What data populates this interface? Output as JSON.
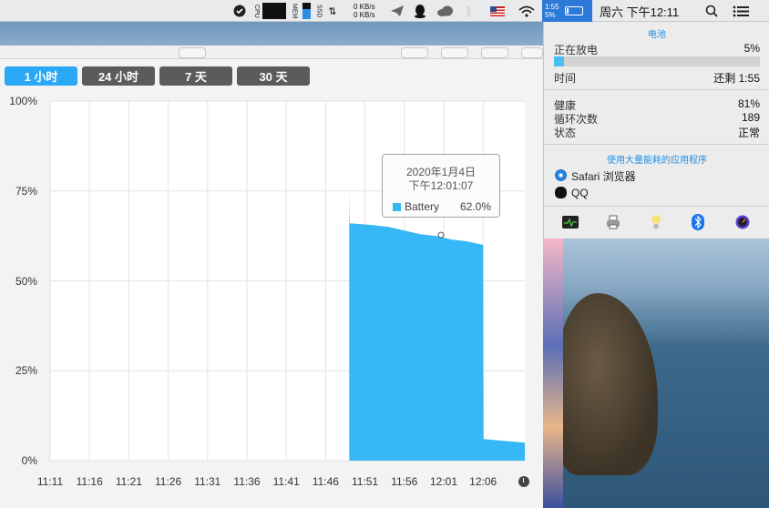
{
  "menubar": {
    "cpu_label": "CPU",
    "mem_label": "MEM",
    "ssd_label": "SSD",
    "net_up": "0 KB/s",
    "net_down": "0 KB/s",
    "battery_time": "1:55",
    "battery_pct": "5%",
    "clock": "周六 下午12:11",
    "icons": [
      "shield-check-icon",
      "telegram-icon",
      "qq-icon",
      "cloud-icon",
      "bluetooth-icon",
      "us-flag-icon",
      "wifi-icon",
      "battery-icon",
      "spotlight-icon",
      "control-center-icon"
    ]
  },
  "window": {
    "tabs": [
      {
        "label": "1 小时",
        "active": true
      },
      {
        "label": "24 小时",
        "active": false
      },
      {
        "label": "7 天",
        "active": false
      },
      {
        "label": "30 天",
        "active": false
      }
    ]
  },
  "chart_data": {
    "type": "area",
    "series": [
      {
        "name": "Battery",
        "color": "#35b8f5",
        "x": [
          "11:49",
          "11:49",
          "11:52",
          "11:54",
          "11:56",
          "11:58",
          "12:00",
          "12:02",
          "12:04",
          "12:06",
          "12:06",
          "12:11"
        ],
        "values": [
          75,
          66,
          65.5,
          65,
          64,
          63,
          62.5,
          61.5,
          61,
          60,
          6,
          5
        ]
      }
    ],
    "x_ticks": [
      "11:11",
      "11:16",
      "11:21",
      "11:26",
      "11:31",
      "11:36",
      "11:41",
      "11:46",
      "11:51",
      "11:56",
      "12:01",
      "12:06"
    ],
    "y_ticks": [
      "100%",
      "75%",
      "50%",
      "25%",
      "0%"
    ],
    "ylim": [
      0,
      100
    ],
    "grid": true,
    "tooltip": {
      "date": "2020年1月4日",
      "time": "下午12:01:07",
      "series": "Battery",
      "value": "62.0%"
    }
  },
  "panel": {
    "title": "电池",
    "status_label": "正在放电",
    "status_value": "5%",
    "charge_fraction": 0.05,
    "time_label": "时间",
    "time_value": "还剩 1:55",
    "health_label": "健康",
    "health_value": "81%",
    "cycles_label": "循环次数",
    "cycles_value": "189",
    "state_label": "状态",
    "state_value": "正常",
    "apps_title": "使用大量能耗的应用程序",
    "apps": [
      {
        "name": "Safari 浏览器",
        "icon": "safari-icon"
      },
      {
        "name": "QQ",
        "icon": "qq-icon"
      }
    ],
    "toolbar_icons": [
      "activity-monitor-icon",
      "printer-icon",
      "light-bulb-icon",
      "bluetooth-icon",
      "speedometer-icon"
    ]
  }
}
